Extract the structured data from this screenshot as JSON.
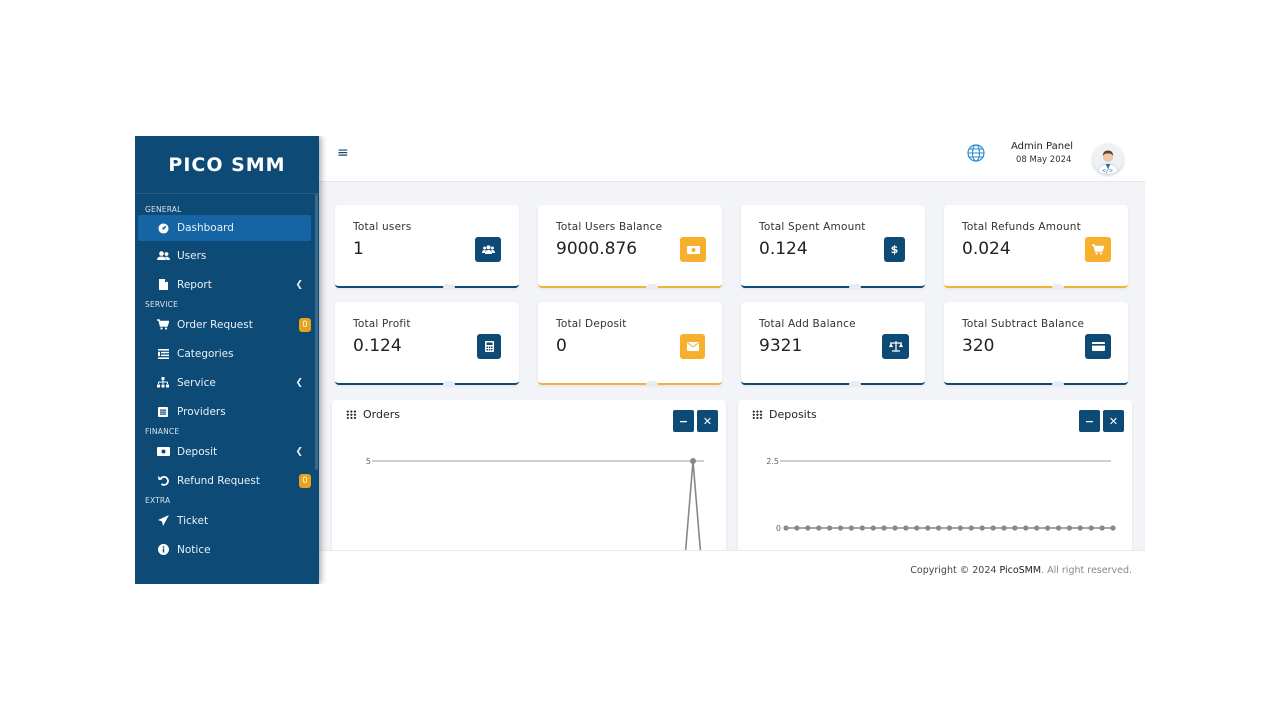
{
  "brand": "PICO SMM",
  "sidebar": {
    "sections": {
      "general": "GENERAL",
      "service": "SERVICE",
      "finance": "FINANCE",
      "extra": "EXTRA"
    },
    "items": [
      {
        "label": "Dashboard",
        "icon": "dashboard-icon"
      },
      {
        "label": "Users",
        "icon": "users-icon"
      },
      {
        "label": "Report",
        "icon": "file-icon"
      },
      {
        "label": "Order Request",
        "icon": "cart-icon",
        "badge": "0"
      },
      {
        "label": "Categories",
        "icon": "list-icon"
      },
      {
        "label": "Service",
        "icon": "sitemap-icon"
      },
      {
        "label": "Providers",
        "icon": "list-alt-icon"
      },
      {
        "label": "Deposit",
        "icon": "money-icon"
      },
      {
        "label": "Refund Request",
        "icon": "undo-icon",
        "badge": "0"
      },
      {
        "label": "Ticket",
        "icon": "paper-plane-icon"
      },
      {
        "label": "Notice",
        "icon": "info-icon"
      }
    ]
  },
  "topbar": {
    "title": "Admin Panel",
    "date": "08 May 2024"
  },
  "stats": [
    {
      "label": "Total users",
      "value": "1",
      "icon": "users-icon"
    },
    {
      "label": "Total Users Balance",
      "value": "9000.876",
      "icon": "money-bill-icon"
    },
    {
      "label": "Total Spent Amount",
      "value": "0.124",
      "icon": "dollar-icon"
    },
    {
      "label": "Total Refunds Amount",
      "value": "0.024",
      "icon": "cart-icon"
    },
    {
      "label": "Total Profit",
      "value": "0.124",
      "icon": "calculator-icon"
    },
    {
      "label": "Total Deposit",
      "value": "0",
      "icon": "envelope-icon"
    },
    {
      "label": "Total Add Balance",
      "value": "9321",
      "icon": "balance-scale-icon"
    },
    {
      "label": "Total Subtract Balance",
      "value": "320",
      "icon": "credit-card-icon"
    }
  ],
  "panels": {
    "orders": {
      "title": "Orders",
      "ytick": "5"
    },
    "deposits": {
      "title": "Deposits",
      "yticks": [
        "2.5",
        "0"
      ]
    }
  },
  "chart_data": [
    {
      "type": "line",
      "title": "Orders",
      "y_ticks": [
        5
      ],
      "series": [
        {
          "values": [
            5
          ]
        }
      ]
    },
    {
      "type": "line",
      "title": "Deposits",
      "y_ticks": [
        2.5,
        0
      ],
      "series": [
        {
          "values": [
            0,
            0,
            0,
            0,
            0,
            0,
            0,
            0,
            0,
            0,
            0,
            0,
            0,
            0,
            0,
            0,
            0,
            0,
            0,
            0,
            0,
            0,
            0,
            0,
            0,
            0,
            0,
            0,
            0,
            0,
            0
          ]
        }
      ]
    }
  ],
  "footer": {
    "prefix": "Copyright © 2024 ",
    "brand": "PicoSMM",
    "suffix": ". All right reserved."
  },
  "colors": {
    "primary": "#0d4a75",
    "accent": "#f6b02d",
    "active": "#1564a3"
  }
}
